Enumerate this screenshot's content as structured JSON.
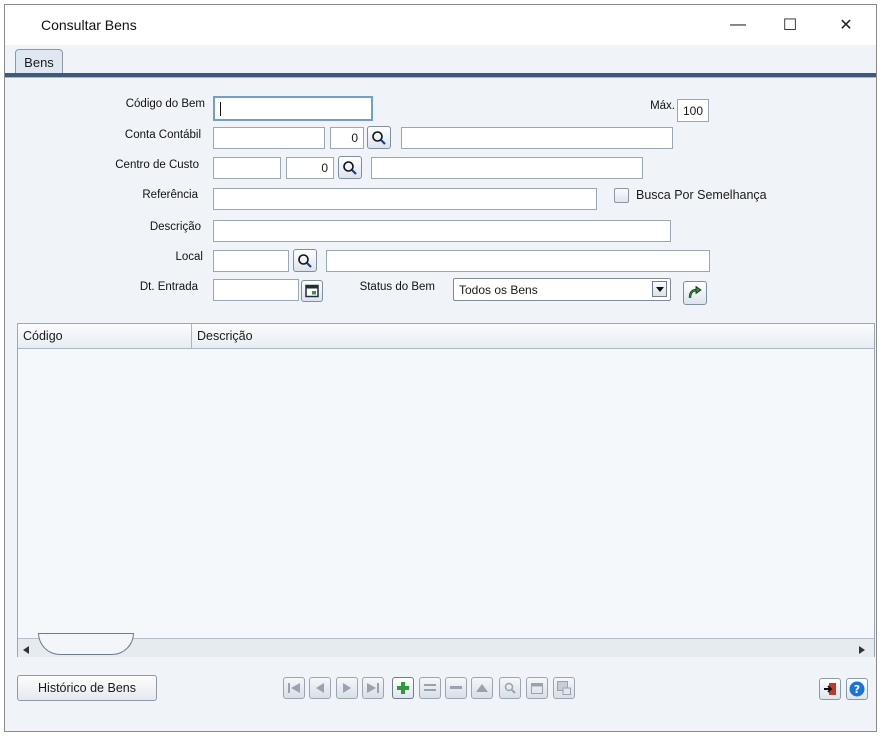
{
  "window": {
    "title": "Consultar Bens",
    "minimize": "—",
    "maximize": "☐",
    "close": "✕"
  },
  "tabs": [
    {
      "label": "Bens"
    }
  ],
  "form": {
    "codigo_label": "Código do Bem",
    "codigo_value": "",
    "max_label": "Máx.",
    "max_value": "100",
    "conta_label": "Conta Contábil",
    "conta_value": "",
    "conta_num": "0",
    "conta_desc": "",
    "centro_label": "Centro de Custo",
    "centro_value": "",
    "centro_num": "0",
    "centro_desc": "",
    "referencia_label": "Referência",
    "referencia_value": "",
    "busca_label": "Busca Por Semelhança",
    "busca_checked": false,
    "descricao_label": "Descrição",
    "descricao_value": "",
    "local_label": "Local",
    "local_value": "",
    "local_desc": "",
    "dt_label": "Dt. Entrada",
    "dt_value": "",
    "status_label": "Status do Bem",
    "status_value": "Todos os Bens"
  },
  "grid": {
    "columns": [
      "Código",
      "Descrição"
    ],
    "rows": []
  },
  "footer": {
    "historico_label": "Histórico de Bens",
    "nav_buttons": [
      "first",
      "prev",
      "next",
      "last",
      "add",
      "edit",
      "delete",
      "up",
      "search",
      "view",
      "export"
    ]
  },
  "colors": {
    "accent": "#3d5a7a",
    "add_green": "#2e9a3a",
    "help_blue": "#1a73d8",
    "exit_red": "#c0392b"
  }
}
